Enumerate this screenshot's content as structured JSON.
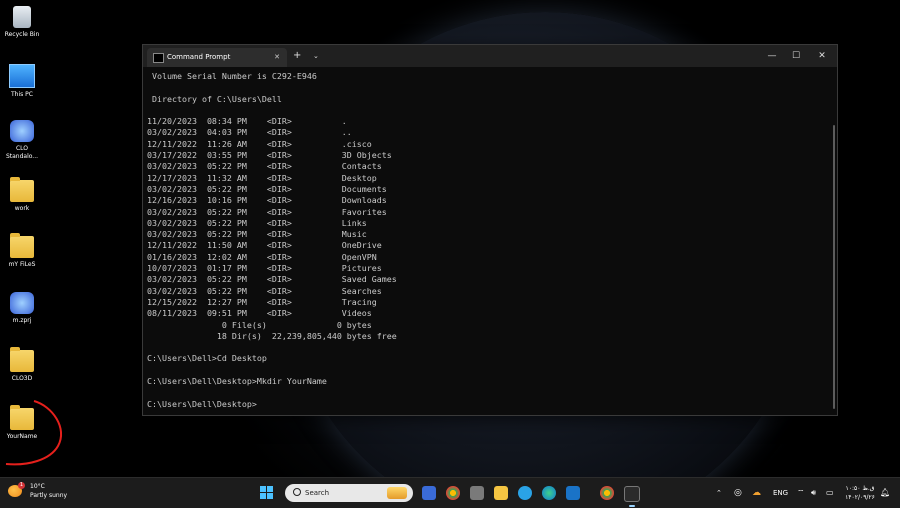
{
  "desktop_icons": [
    {
      "label": "Recycle Bin",
      "kind": "bin"
    },
    {
      "label": "This PC",
      "kind": "pc"
    },
    {
      "label": "CLO Standalo...",
      "kind": "app"
    },
    {
      "label": "work",
      "kind": "folder"
    },
    {
      "label": "mY FiLeS",
      "kind": "folder"
    },
    {
      "label": "m.zprj",
      "kind": "app"
    },
    {
      "label": "CLO3D",
      "kind": "folder"
    },
    {
      "label": "YourName",
      "kind": "folder"
    }
  ],
  "window": {
    "tab_label": "Command Prompt",
    "tab_close": "✕",
    "new_tab": "+",
    "dropdown": "⌄",
    "minimize": "—",
    "maximize": "☐",
    "close": "✕"
  },
  "terminal_lines": [
    " Volume Serial Number is C292-E946",
    "",
    " Directory of C:\\Users\\Dell",
    "",
    "11/20/2023  08:34 PM    <DIR>          .",
    "03/02/2023  04:03 PM    <DIR>          ..",
    "12/11/2022  11:26 AM    <DIR>          .cisco",
    "03/17/2022  03:55 PM    <DIR>          3D Objects",
    "03/02/2023  05:22 PM    <DIR>          Contacts",
    "12/17/2023  11:32 AM    <DIR>          Desktop",
    "03/02/2023  05:22 PM    <DIR>          Documents",
    "12/16/2023  10:16 PM    <DIR>          Downloads",
    "03/02/2023  05:22 PM    <DIR>          Favorites",
    "03/02/2023  05:22 PM    <DIR>          Links",
    "03/02/2023  05:22 PM    <DIR>          Music",
    "12/11/2022  11:50 AM    <DIR>          OneDrive",
    "01/16/2023  12:02 AM    <DIR>          OpenVPN",
    "10/07/2023  01:17 PM    <DIR>          Pictures",
    "03/02/2023  05:22 PM    <DIR>          Saved Games",
    "03/02/2023  05:22 PM    <DIR>          Searches",
    "12/15/2022  12:27 PM    <DIR>          Tracing",
    "08/11/2023  09:51 PM    <DIR>          Videos",
    "               0 File(s)              0 bytes",
    "              18 Dir(s)  22,239,805,440 bytes free",
    "",
    "C:\\Users\\Dell>Cd Desktop",
    "",
    "C:\\Users\\Dell\\Desktop>Mkdir YourName",
    "",
    "C:\\Users\\Dell\\Desktop>"
  ],
  "taskbar": {
    "weather_temp": "10°C",
    "weather_desc": "Partly sunny",
    "weather_badge": "1",
    "search_placeholder": "Search",
    "tray_chevron": "⌃",
    "language": "ENG",
    "clock_time": "۱۰:۵۰ ق.ظ",
    "clock_date": "۱۴۰۲/۰۹/۲۶"
  },
  "colors": {
    "terminal_bg": "#0c0c0c",
    "terminal_text": "#cccccc",
    "taskbar_bg": "#1c1c1c",
    "annotation_red": "#e5201c"
  }
}
